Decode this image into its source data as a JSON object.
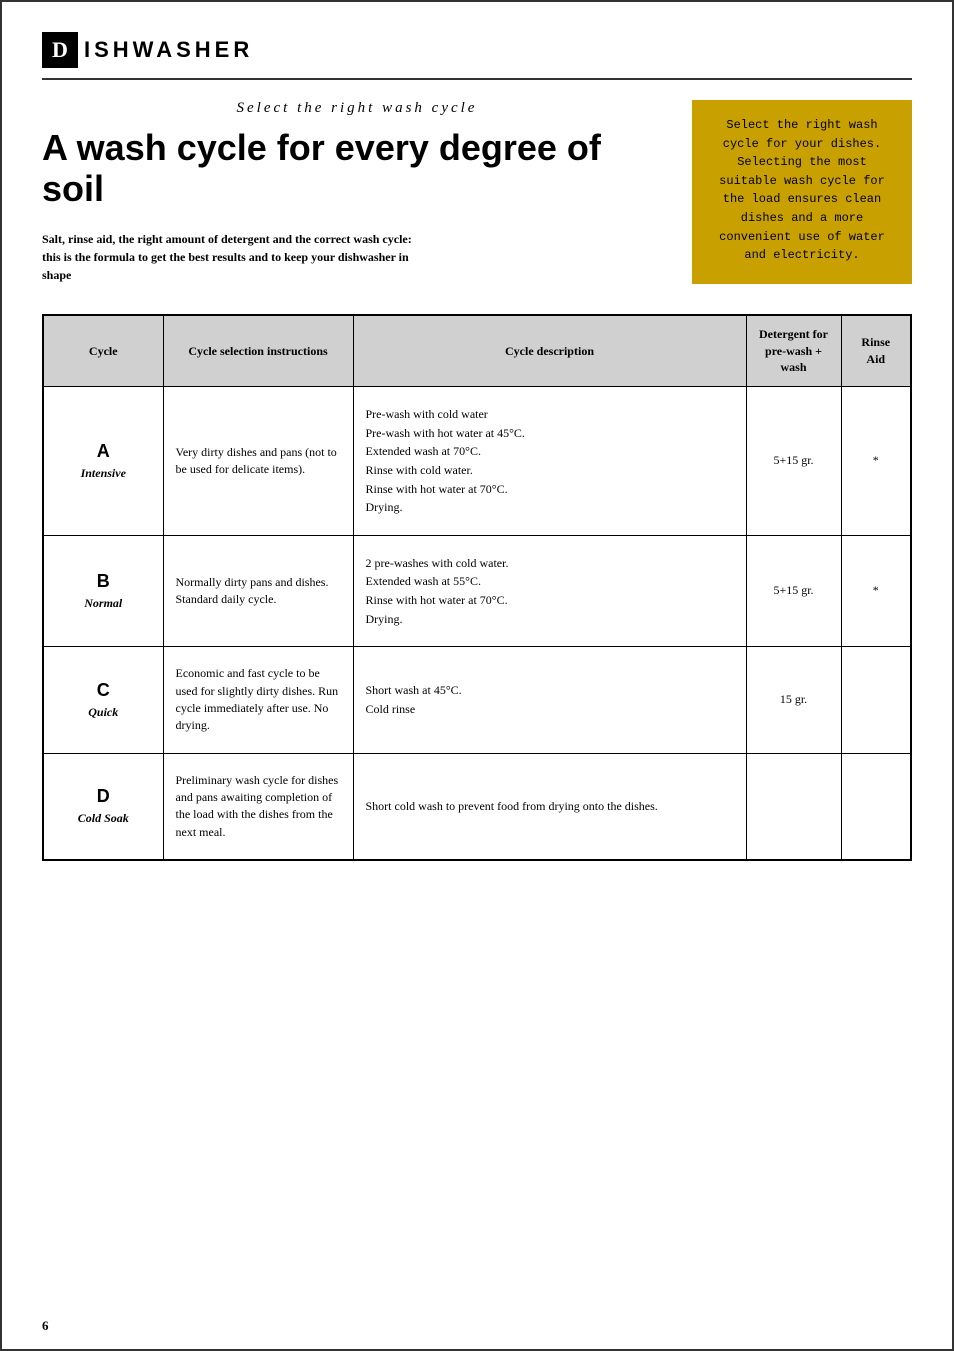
{
  "header": {
    "logo_letter": "D",
    "logo_title": "ISHWASHER"
  },
  "hero": {
    "subtitle": "Select the right wash cycle",
    "main_title": "A wash cycle for every degree of soil",
    "intro_text": "Salt, rinse aid, the right amount of detergent and the correct wash cycle: this is the formula to get the best results and to keep your dishwasher in shape"
  },
  "sidebar": {
    "text": "Select the right wash cycle for your dishes. Selecting the most suitable wash cycle for the load ensures clean dishes and a more convenient use of water and electricity."
  },
  "table": {
    "headers": {
      "cycle": "Cycle",
      "selection": "Cycle selection instructions",
      "description": "Cycle description",
      "detergent": "Detergent for pre-wash + wash",
      "rinse": "Rinse Aid"
    },
    "rows": [
      {
        "letter": "A",
        "name": "Intensive",
        "selection": "Very dirty dishes and pans (not to be used for delicate items).",
        "description": "Pre-wash with  cold water\nPre-wash with hot water at 45°C.\nExtended wash at 70°C.\nRinse with cold water.\nRinse with hot water at 70°C.\nDrying.",
        "detergent": "5+15 gr.",
        "rinse_aid": "*"
      },
      {
        "letter": "B",
        "name": "Normal",
        "selection": "Normally dirty pans and dishes. Standard daily cycle.",
        "description": "2 pre-washes with cold water.\nExtended wash at 55°C.\nRinse with hot water at 70°C.\nDrying.",
        "detergent": "5+15 gr.",
        "rinse_aid": "*"
      },
      {
        "letter": "C",
        "name": "Quick",
        "selection": "Economic and fast cycle to be used for slightly dirty dishes.\nRun cycle immediately after use. No drying.",
        "description": "Short wash at 45°C.\nCold rinse",
        "detergent": "15 gr.",
        "rinse_aid": ""
      },
      {
        "letter": "D",
        "name": "Cold Soak",
        "selection": "Preliminary wash cycle for dishes and pans awaiting completion of the load with the dishes from the next meal.",
        "description": "Short cold wash to prevent food from drying onto the dishes.",
        "detergent": "",
        "rinse_aid": ""
      }
    ]
  },
  "page_number": "6"
}
